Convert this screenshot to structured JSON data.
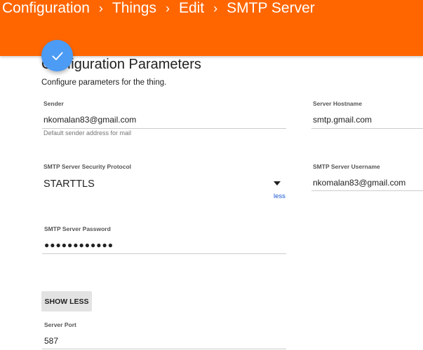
{
  "header": {
    "breadcrumb": [
      "Configuration",
      "Things",
      "Edit",
      "SMTP Server"
    ],
    "separator": "›"
  },
  "fab": {
    "icon": "check-icon"
  },
  "section": {
    "title": "Configuration Parameters",
    "description": "Configure parameters for the thing."
  },
  "fields": {
    "sender": {
      "label": "Sender",
      "value": "nkomalan83@gmail.com",
      "help": "Default sender address for mail"
    },
    "hostname": {
      "label": "Server Hostname",
      "value": "smtp.gmail.com"
    },
    "security": {
      "label": "SMTP Server Security Protocol",
      "value": "STARTTLS",
      "toggle_link": "less"
    },
    "username": {
      "label": "SMTP Server Username",
      "value": "nkomalan83@gmail.com"
    },
    "password": {
      "label": "SMTP Server Password",
      "value": "●●●●●●●●●●●●"
    },
    "port": {
      "label": "Server Port",
      "value": "587"
    }
  },
  "actions": {
    "show_less_label": "SHOW LESS"
  },
  "colors": {
    "header_bg": "#ff6600",
    "fab_bg": "#4c9bf4",
    "link": "#1a57d4"
  }
}
